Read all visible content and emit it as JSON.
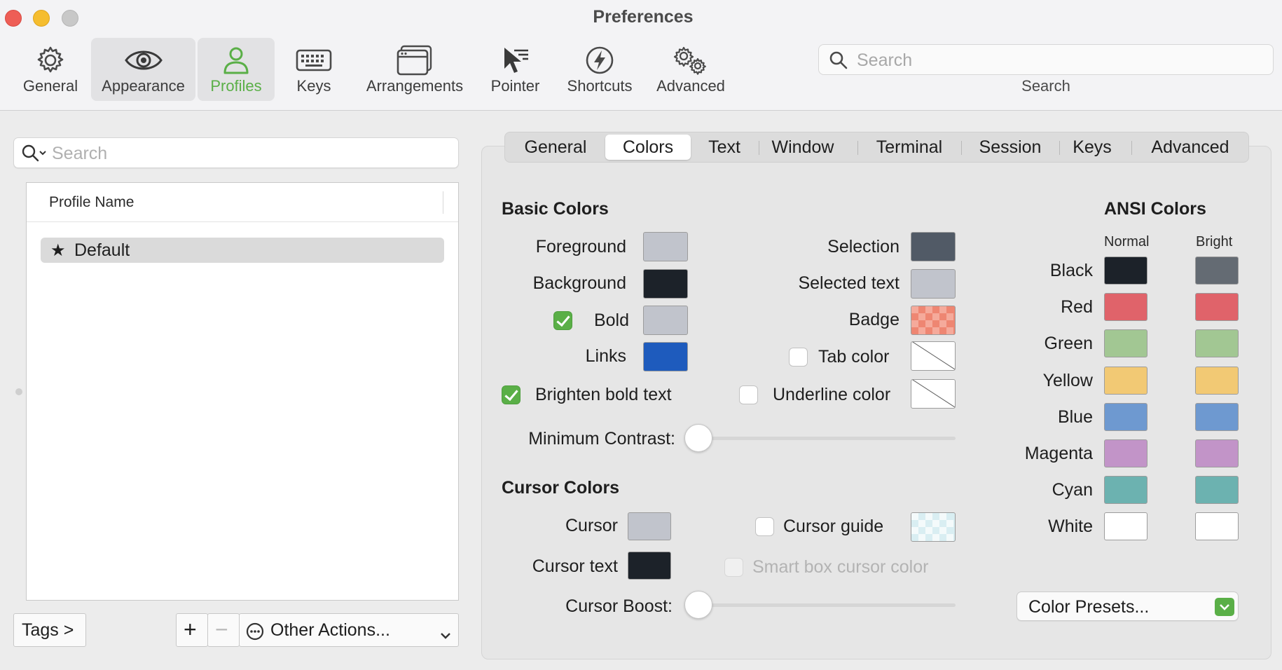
{
  "window": {
    "title": "Preferences"
  },
  "toolbar": {
    "items": [
      {
        "label": "General",
        "icon": "gear-icon"
      },
      {
        "label": "Appearance",
        "icon": "eye-icon"
      },
      {
        "label": "Profiles",
        "icon": "person-icon"
      },
      {
        "label": "Keys",
        "icon": "keyboard-icon"
      },
      {
        "label": "Arrangements",
        "icon": "window-icon"
      },
      {
        "label": "Pointer",
        "icon": "pointer-icon"
      },
      {
        "label": "Shortcuts",
        "icon": "lightning-icon"
      },
      {
        "label": "Advanced",
        "icon": "gears-icon"
      }
    ],
    "active": "Profiles",
    "search": {
      "placeholder": "Search",
      "label": "Search"
    }
  },
  "profiles": {
    "search_placeholder": "Search",
    "column_header": "Profile Name",
    "rows": [
      {
        "name": "Default",
        "starred": true
      }
    ],
    "tags_button": "Tags >",
    "add_label": "+",
    "remove_label": "−",
    "other_actions": "Other Actions..."
  },
  "tabs": {
    "items": [
      "General",
      "Colors",
      "Text",
      "Window",
      "Terminal",
      "Session",
      "Keys",
      "Advanced"
    ],
    "selected": "Colors"
  },
  "basic_colors": {
    "title": "Basic Colors",
    "foreground": {
      "label": "Foreground",
      "color": "#c1c4cc"
    },
    "background": {
      "label": "Background",
      "color": "#1c2229"
    },
    "bold": {
      "label": "Bold",
      "checked": true,
      "color": "#c1c4cc"
    },
    "links": {
      "label": "Links",
      "color": "#1e5bbd"
    },
    "brighten_bold": {
      "label": "Brighten bold text",
      "checked": true
    },
    "selection": {
      "label": "Selection",
      "color": "#515a66"
    },
    "selected_text": {
      "label": "Selected text",
      "color": "#c1c4cc"
    },
    "badge": {
      "label": "Badge",
      "color": "#ee8672"
    },
    "tab_color": {
      "label": "Tab color",
      "checked": false,
      "color": "none"
    },
    "underline_color": {
      "label": "Underline color",
      "checked": false,
      "color": "none"
    },
    "minimum_contrast": {
      "label": "Minimum Contrast:",
      "value": 0
    }
  },
  "cursor_colors": {
    "title": "Cursor Colors",
    "cursor": {
      "label": "Cursor",
      "color": "#c1c4cc"
    },
    "cursor_text": {
      "label": "Cursor text",
      "color": "#1c2229"
    },
    "cursor_guide": {
      "label": "Cursor guide",
      "checked": false,
      "color": "#d9eef2"
    },
    "smart_box": {
      "label": "Smart box cursor color",
      "checked": false,
      "disabled": true
    },
    "cursor_boost": {
      "label": "Cursor Boost:",
      "value": 0
    }
  },
  "ansi": {
    "title": "ANSI Colors",
    "normal_label": "Normal",
    "bright_label": "Bright",
    "rows": [
      {
        "name": "Black",
        "normal": "#1c2229",
        "bright": "#646b73"
      },
      {
        "name": "Red",
        "normal": "#e0636a",
        "bright": "#e0636a"
      },
      {
        "name": "Green",
        "normal": "#a2c793",
        "bright": "#a2c793"
      },
      {
        "name": "Yellow",
        "normal": "#f2c974",
        "bright": "#f2c974"
      },
      {
        "name": "Blue",
        "normal": "#6e99d0",
        "bright": "#6e99d0"
      },
      {
        "name": "Magenta",
        "normal": "#c294c8",
        "bright": "#c294c8"
      },
      {
        "name": "Cyan",
        "normal": "#6cb2b0",
        "bright": "#6cb2b0"
      },
      {
        "name": "White",
        "normal": "#ffffff",
        "bright": "#ffffff"
      }
    ],
    "presets_button": "Color Presets..."
  },
  "colors": {
    "accent": "#5aaf47"
  }
}
